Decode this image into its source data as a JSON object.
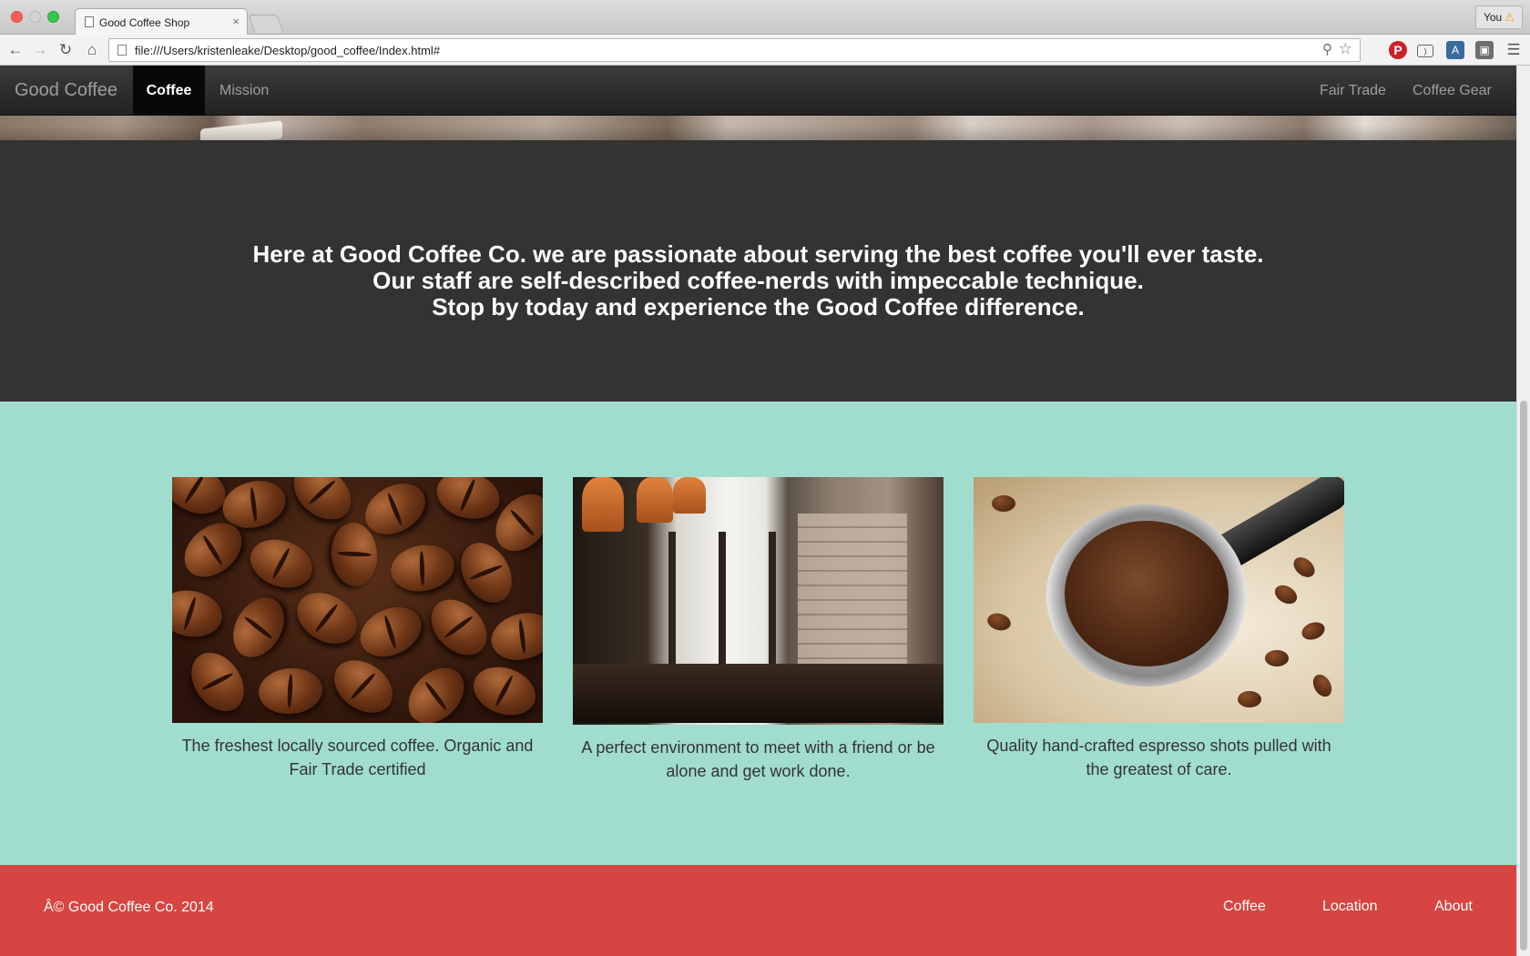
{
  "browser": {
    "tab_title": "Good Coffee Shop",
    "tab_close": "×",
    "profile_label": "You",
    "profile_warning": "⚠",
    "url": "file:///Users/kristenleake/Desktop/good_coffee/Index.html#"
  },
  "nav": {
    "brand": "Good Coffee",
    "items_left": [
      "Coffee",
      "Mission"
    ],
    "active_item": "Coffee",
    "items_right": [
      "Fair Trade",
      "Coffee Gear"
    ]
  },
  "intro": {
    "lines": [
      "Here at Good Coffee Co. we are passionate about serving the best coffee you'll ever taste.",
      "Our staff are self-described coffee-nerds with impeccable technique.",
      "Stop by today and experience the Good Coffee difference."
    ]
  },
  "features": [
    {
      "caption": "The freshest locally sourced coffee. Organic and Fair Trade certified"
    },
    {
      "caption": "A perfect environment to meet with a friend or be alone and get work done."
    },
    {
      "caption": "Quality hand-crafted espresso shots pulled with the greatest of care."
    }
  ],
  "footer": {
    "copyright": "Â© Good Coffee Co. 2014",
    "links": [
      "Coffee",
      "Location",
      "About"
    ]
  },
  "colors": {
    "navbar": "#222222",
    "intro_bg": "#333333",
    "features_bg": "#a0ddcf",
    "footer_bg": "#d64541"
  }
}
